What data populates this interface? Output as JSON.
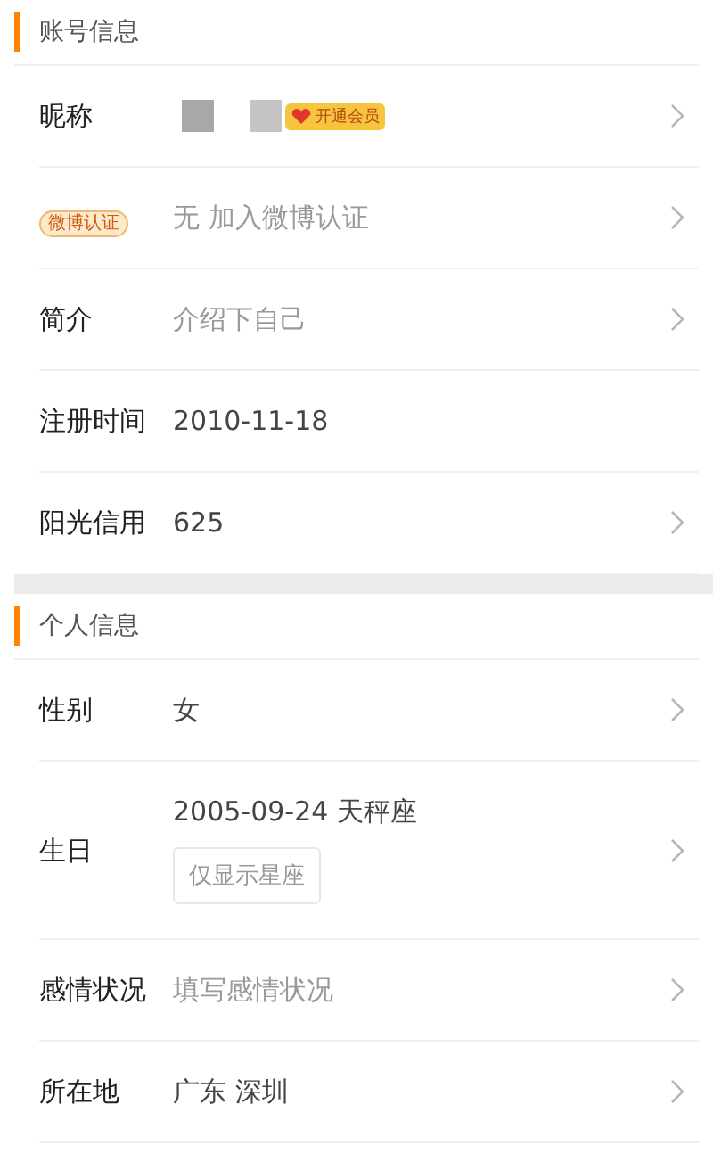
{
  "sections": [
    {
      "title": "账号信息",
      "rows": [
        {
          "kind": "nickname",
          "label": "昵称",
          "badge": "开通会员",
          "chevron": true
        },
        {
          "kind": "badge-label",
          "label": "微博认证",
          "value": "无 加入微博认证",
          "hint": true,
          "chevron": true
        },
        {
          "kind": "text",
          "label": "简介",
          "value": "介绍下自己",
          "hint": true,
          "chevron": true
        },
        {
          "kind": "text",
          "label": "注册时间",
          "value": "2010-11-18",
          "hint": false,
          "chevron": false
        },
        {
          "kind": "text",
          "label": "阳光信用",
          "value": "625",
          "hint": false,
          "chevron": true
        }
      ]
    },
    {
      "title": "个人信息",
      "rows": [
        {
          "kind": "text",
          "label": "性别",
          "value": "女",
          "hint": false,
          "chevron": true
        },
        {
          "kind": "text",
          "label": "生日",
          "value": "2005-09-24 天秤座",
          "hint": false,
          "chevron": true,
          "option": "仅显示星座"
        },
        {
          "kind": "text",
          "label": "感情状况",
          "value": "填写感情状况",
          "hint": true,
          "chevron": true
        },
        {
          "kind": "text",
          "label": "所在地",
          "value": "广东 深圳",
          "hint": false,
          "chevron": true
        }
      ]
    }
  ]
}
